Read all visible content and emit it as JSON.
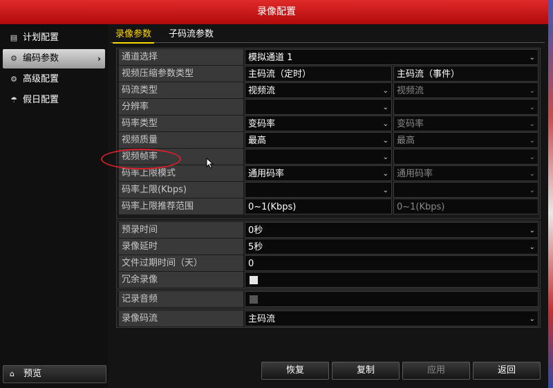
{
  "window": {
    "title": "录像配置"
  },
  "sidebar": {
    "items": [
      {
        "label": "计划配置",
        "icon": "calendar-icon",
        "glyph": "▤"
      },
      {
        "label": "编码参数",
        "icon": "gear-icon",
        "glyph": "⚙",
        "arrow": "›"
      },
      {
        "label": "高级配置",
        "icon": "gears-icon",
        "glyph": "⚙"
      },
      {
        "label": "假日配置",
        "icon": "umbrella-icon",
        "glyph": "☂"
      }
    ],
    "preview": {
      "label": "预览",
      "icon": "home-icon",
      "glyph": "⌂"
    }
  },
  "tabs": [
    {
      "label": "录像参数"
    },
    {
      "label": "子码流参数"
    }
  ],
  "stream": {
    "channel_label": "通道选择",
    "channel_value": "模拟通道 1",
    "rows": [
      {
        "label": "视频压缩参数类型",
        "v1": "主码流（定时）",
        "v2": "主码流（事件）"
      },
      {
        "label": "码流类型",
        "v1": "视频流",
        "v2": "视频流"
      },
      {
        "label": "分辨率",
        "v1": "",
        "v2": ""
      },
      {
        "label": "码率类型",
        "v1": "变码率",
        "v2": "变码率"
      },
      {
        "label": "视频质量",
        "v1": "最高",
        "v2": "最高"
      },
      {
        "label": "视频帧率",
        "v1": "",
        "v2": ""
      },
      {
        "label": "码率上限模式",
        "v1": "通用码率",
        "v2": "通用码率"
      },
      {
        "label": "码率上限(Kbps)",
        "v1": "",
        "v2": ""
      },
      {
        "label": "码率上限推荐范围",
        "v1": "0~1(Kbps)",
        "v2": "0~1(Kbps)"
      }
    ]
  },
  "record": {
    "prerecord_label": "预录时间",
    "prerecord_value": "0秒",
    "delay_label": "录像延时",
    "delay_value": "5秒",
    "expire_label": "文件过期时间（天）",
    "expire_value": "0",
    "redundant_label": "冗余录像"
  },
  "audio_label": "记录音频",
  "record_stream_label": "录像码流",
  "record_stream_value": "主码流",
  "buttons": {
    "restore": "恢复",
    "copy": "复制",
    "apply": "应用",
    "back": "返回"
  },
  "dropdown_glyph": "⌄",
  "colors": {
    "title_red": "#c81414",
    "tab_active": "#ffd800",
    "annotation": "#d4202a"
  }
}
